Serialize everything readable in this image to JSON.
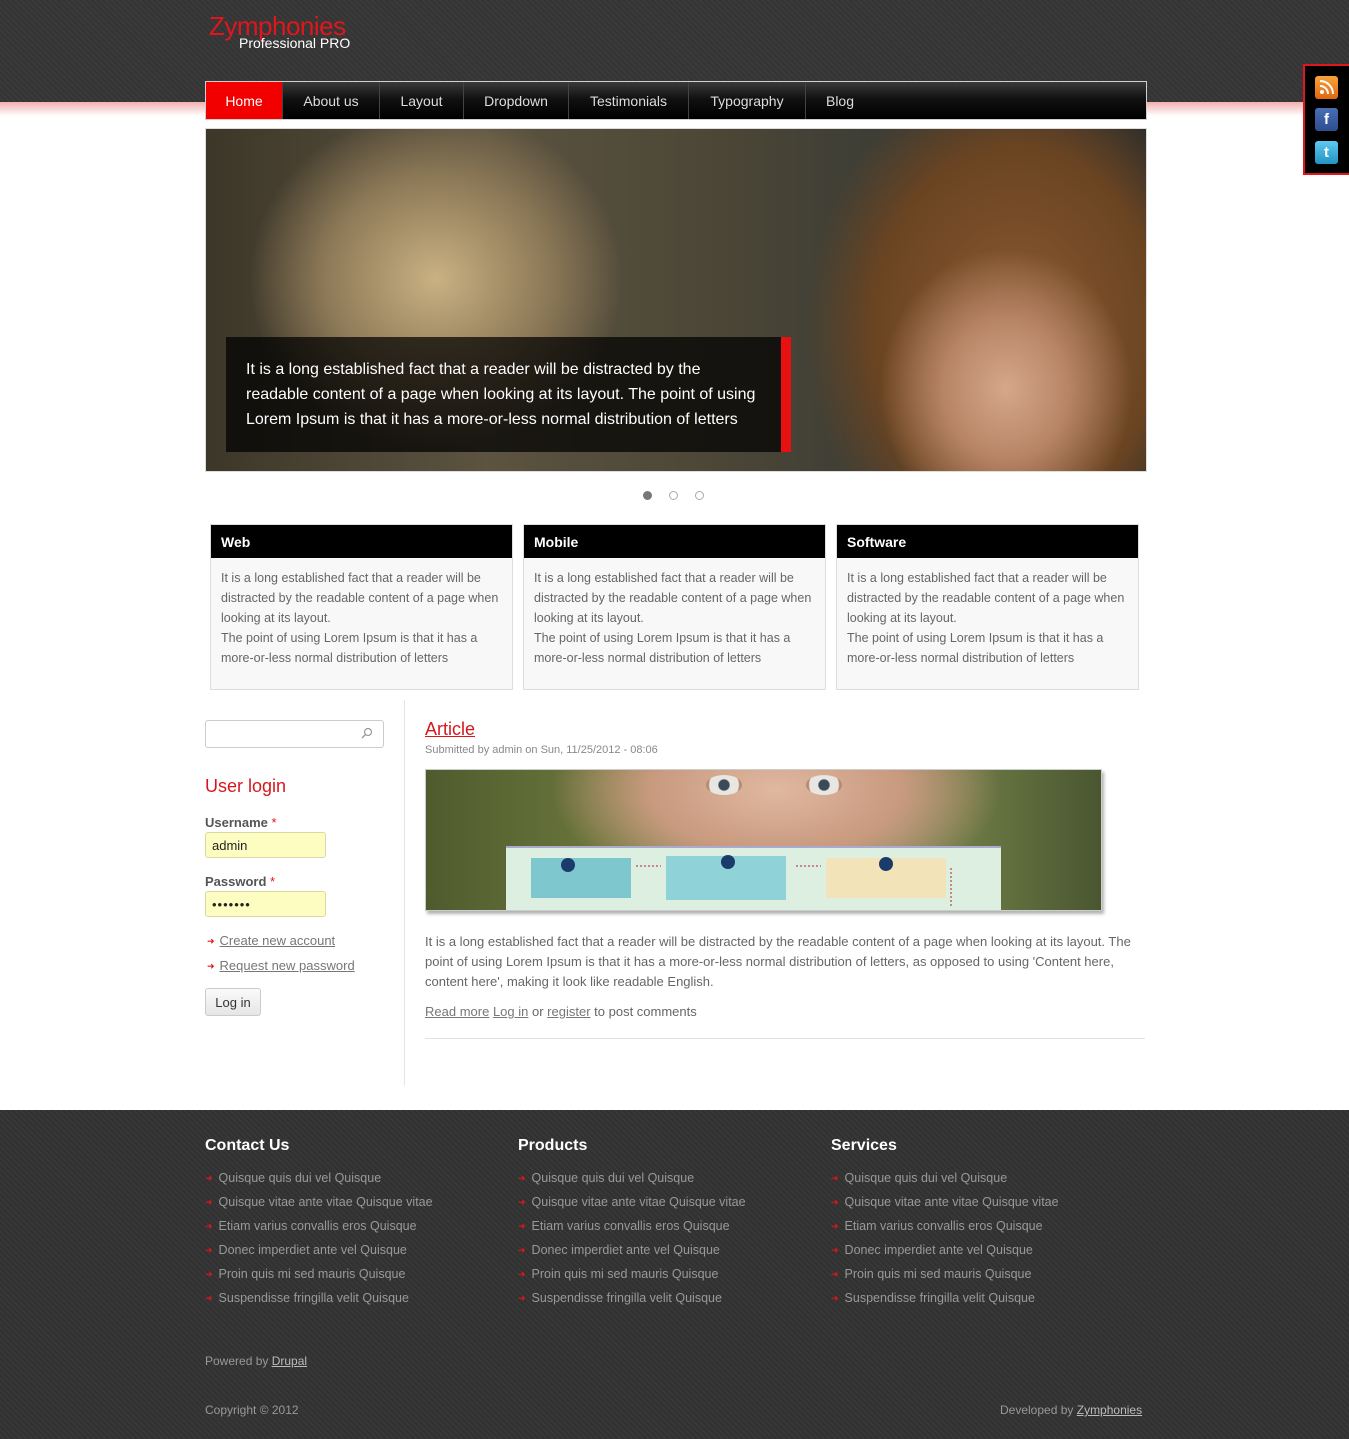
{
  "brand": {
    "name": "Zymphonies",
    "tagline": "Professional PRO"
  },
  "nav": [
    {
      "label": "Home",
      "active": true
    },
    {
      "label": "About us"
    },
    {
      "label": "Layout"
    },
    {
      "label": "Dropdown"
    },
    {
      "label": "Testimonials"
    },
    {
      "label": "Typography"
    },
    {
      "label": "Blog"
    }
  ],
  "social": [
    "rss-icon",
    "facebook-icon",
    "twitter-icon"
  ],
  "slider": {
    "caption": "It is a long established fact that a reader will be distracted by the readable content of a page when looking at its layout. The point of using Lorem Ipsum is that it has a more-or-less normal distribution of letters",
    "slides": 3,
    "active_slide": 1
  },
  "features": [
    {
      "title": "Web",
      "text1": "It is a long established fact that a reader will be distracted by the readable content of a page when looking at its layout.",
      "text2": "The point of using Lorem Ipsum is that it has a more-or-less normal distribution of letters"
    },
    {
      "title": "Mobile",
      "text1": "It is a long established fact that a reader will be distracted by the readable content of a page when looking at its layout.",
      "text2": "The point of using Lorem Ipsum is that it has a more-or-less normal distribution of letters"
    },
    {
      "title": "Software",
      "text1": "It is a long established fact that a reader will be distracted by the readable content of a page when looking at its layout.",
      "text2": "The point of using Lorem Ipsum is that it has a more-or-less normal distribution of letters"
    }
  ],
  "sidebar": {
    "search_value": "",
    "login_title": "User login",
    "username_label": "Username",
    "username_value": "admin",
    "password_label": "Password",
    "password_value": "•••••••",
    "required_mark": "*",
    "create_account": "Create new account",
    "request_password": "Request new password",
    "login_button": "Log in"
  },
  "article": {
    "title": "Article",
    "meta": "Submitted by admin on Sun, 11/25/2012 - 08:06",
    "body": "It is a long established fact that a reader will be distracted by the readable content of a page when looking at its layout. The point of using Lorem Ipsum is that it has a more-or-less normal distribution of letters, as opposed to using 'Content here, content here', making it look like readable English.",
    "read_more": "Read more",
    "log_in": "Log in",
    "or": "or",
    "register": "register",
    "post_comments": "to post comments"
  },
  "footer": {
    "columns": [
      {
        "title": "Contact Us",
        "items": [
          "Quisque quis dui vel Quisque",
          "Quisque vitae ante vitae Quisque vitae",
          "Etiam varius convallis eros Quisque",
          "Donec imperdiet ante vel Quisque",
          "Proin quis mi sed mauris Quisque",
          "Suspendisse fringilla velit Quisque"
        ]
      },
      {
        "title": "Products",
        "items": [
          "Quisque quis dui vel Quisque",
          "Quisque vitae ante vitae Quisque vitae",
          "Etiam varius convallis eros Quisque",
          "Donec imperdiet ante vel Quisque",
          "Proin quis mi sed mauris Quisque",
          "Suspendisse fringilla velit Quisque"
        ]
      },
      {
        "title": "Services",
        "items": [
          "Quisque quis dui vel Quisque",
          "Quisque vitae ante vitae Quisque vitae",
          "Etiam varius convallis eros Quisque",
          "Donec imperdiet ante vel Quisque",
          "Proin quis mi sed mauris Quisque",
          "Suspendisse fringilla velit Quisque"
        ]
      }
    ],
    "powered_prefix": "Powered by",
    "powered_link": "Drupal",
    "copyright": "Copyright © 2012",
    "developed_prefix": "Developed by",
    "developed_link": "Zymphonies"
  },
  "colors": {
    "accent": "#e0161c",
    "header_bg": "#353535",
    "footer_bg": "#333333"
  }
}
